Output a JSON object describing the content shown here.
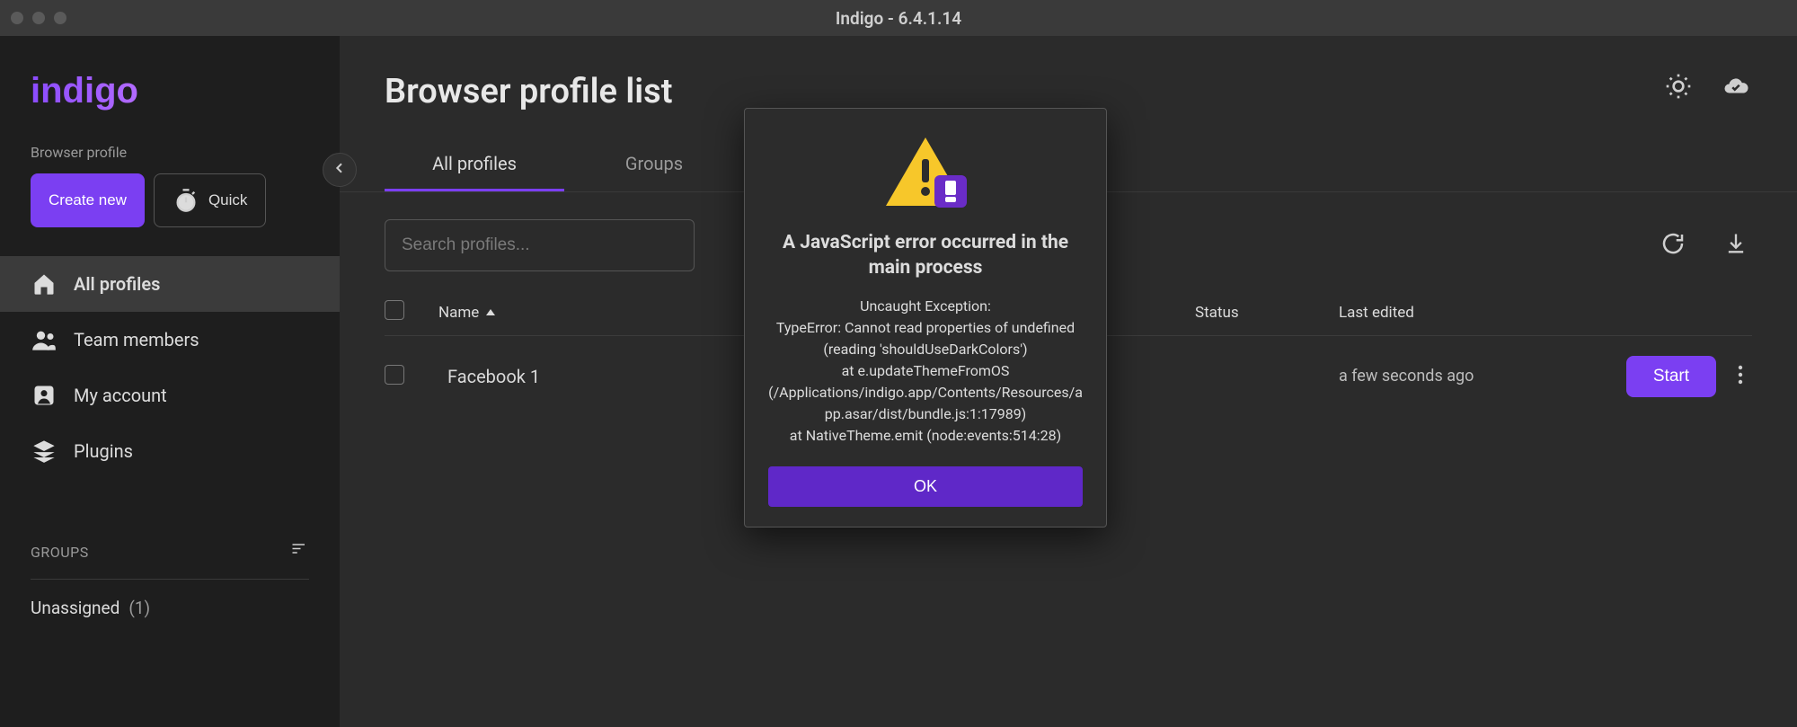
{
  "titlebar": {
    "title": "Indigo - 6.4.1.14"
  },
  "logo": {
    "text": "indigo"
  },
  "sidebar": {
    "section_label": "Browser profile",
    "create_label": "Create new",
    "quick_label": "Quick",
    "nav": [
      {
        "label": "All profiles",
        "icon": "home-icon",
        "active": true
      },
      {
        "label": "Team members",
        "icon": "people-icon",
        "active": false
      },
      {
        "label": "My account",
        "icon": "account-icon",
        "active": false
      },
      {
        "label": "Plugins",
        "icon": "layers-icon",
        "active": false
      }
    ],
    "groups_header": "GROUPS",
    "groups": [
      {
        "name": "Unassigned",
        "count": "(1)"
      }
    ]
  },
  "main": {
    "title": "Browser profile list",
    "tabs": [
      {
        "label": "All profiles",
        "active": true
      },
      {
        "label": "Groups",
        "active": false
      }
    ],
    "search_placeholder": "Search profiles...",
    "columns": {
      "name": "Name",
      "status": "Status",
      "last_edited": "Last edited"
    },
    "rows": [
      {
        "name": "Facebook 1",
        "status": "",
        "last_edited": "a few seconds ago",
        "action_label": "Start"
      }
    ]
  },
  "modal": {
    "title": "A JavaScript error occurred in the main process",
    "body": "Uncaught Exception:\nTypeError: Cannot read properties of undefined (reading 'shouldUseDarkColors')\nat e.updateThemeFromOS (/Applications/indigo.app/Contents/Resources/app.asar/dist/bundle.js:1:17989)\nat NativeTheme.emit (node:events:514:28)",
    "ok": "OK"
  }
}
